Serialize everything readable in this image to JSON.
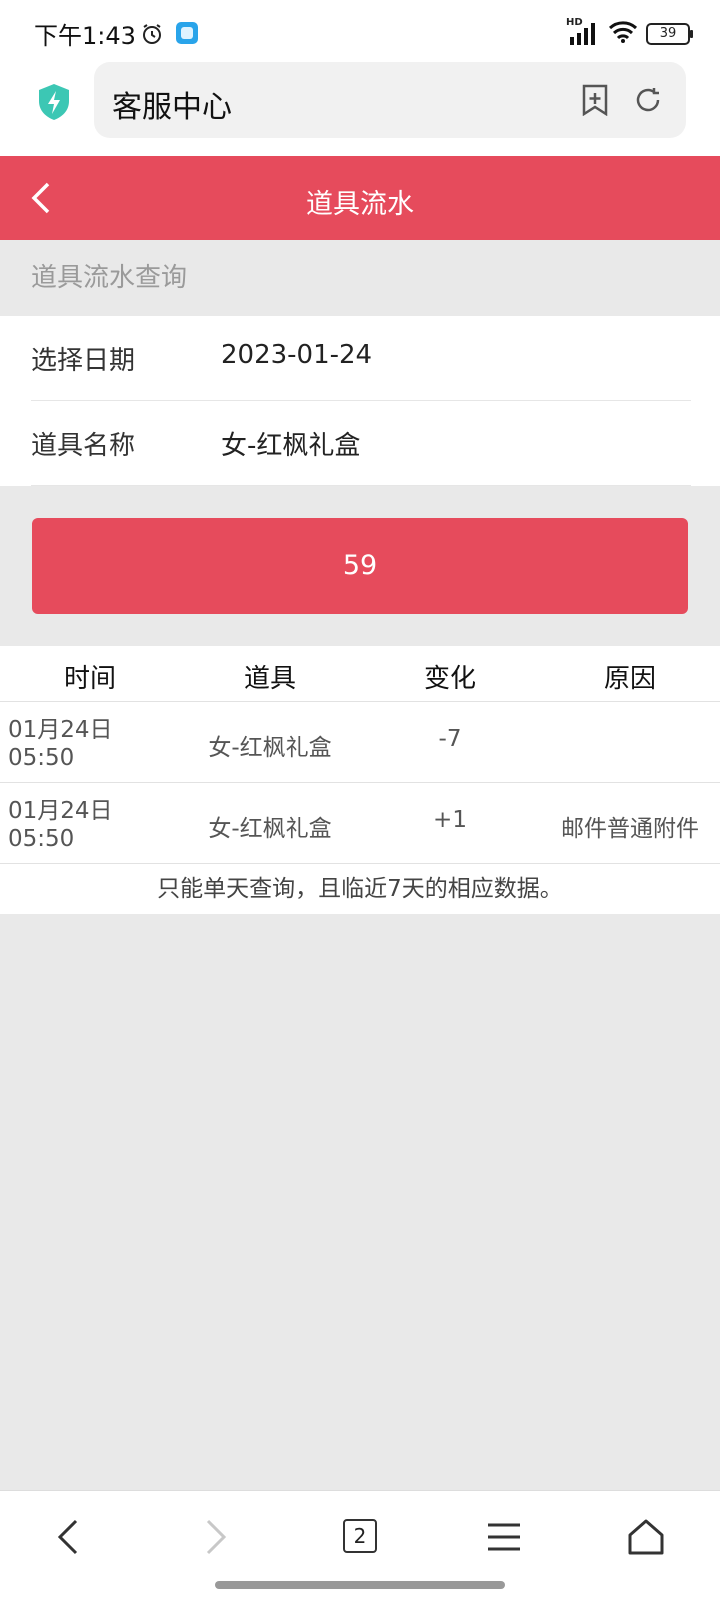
{
  "status_bar": {
    "time": "下午1:43",
    "battery": "39"
  },
  "browser": {
    "url_title": "客服中心"
  },
  "header": {
    "title": "道具流水"
  },
  "section_label": "道具流水查询",
  "form": {
    "date_label": "选择日期",
    "date_value": "2023-01-24",
    "item_label": "道具名称",
    "item_value": "女-红枫礼盒"
  },
  "query_button": "59",
  "table": {
    "headers": [
      "时间",
      "道具",
      "变化",
      "原因"
    ],
    "rows": [
      {
        "time_date": "01月24日",
        "time_clock": "05:50",
        "item": "女-红枫礼盒",
        "change": "-7",
        "reason": ""
      },
      {
        "time_date": "01月24日",
        "time_clock": "05:50",
        "item": "女-红枫礼盒",
        "change": "+1",
        "reason": "邮件普通附件"
      }
    ],
    "note": "只能单天查询，且临近7天的相应数据。"
  },
  "bottom_nav": {
    "tab_count": "2"
  },
  "colors": {
    "accent": "#e64b5c",
    "background": "#e9e9e9"
  }
}
